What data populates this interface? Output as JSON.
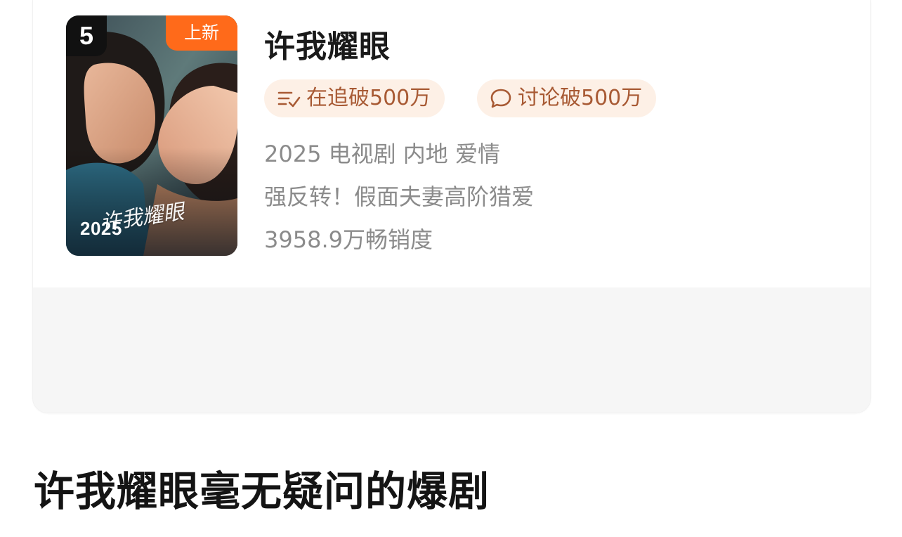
{
  "card": {
    "rank": "5",
    "new_badge": "上新",
    "poster_year": "2025",
    "poster_title": "许我耀眼",
    "title": "许我耀眼",
    "tags": {
      "follow": "在追破500万",
      "discuss": "讨论破500万"
    },
    "meta": {
      "info": "2025 电视剧 内地 爱情",
      "tagline": "强反转！假面夫妻高阶猎爱",
      "sales": "3958.9万畅销度"
    }
  },
  "headline": "许我耀眼毫无疑问的爆剧",
  "colors": {
    "accent_orange": "#ff6a1a",
    "tag_bg": "#fdf0e6",
    "tag_text": "#a85a34",
    "meta_text": "#8b8b8b"
  },
  "icons": {
    "follow": "list-check-icon",
    "discuss": "chat-bubble-icon"
  }
}
